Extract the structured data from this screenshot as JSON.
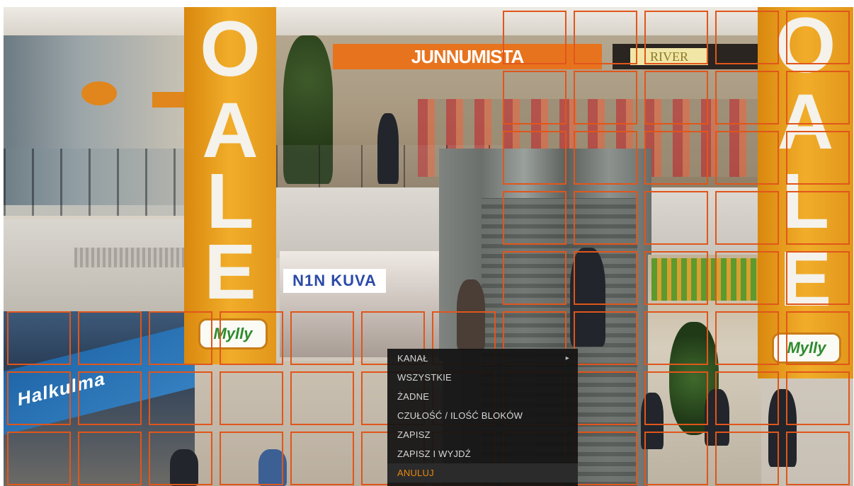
{
  "banners": {
    "left": {
      "letters": [
        "O",
        "A",
        "L",
        "E"
      ],
      "logo": "Mylly"
    },
    "right": {
      "letters": [
        "O",
        "A",
        "L",
        "E"
      ],
      "logo": "Mylly"
    }
  },
  "store_signs": {
    "upper_store": "JUNNUMISTA",
    "upper_store_right": "RIVER",
    "photo_store": "N1N KUVA",
    "lower_left_store": "Halkulma"
  },
  "colors": {
    "grid_cell": "#e0561b",
    "menu_background": "#121212",
    "menu_text": "#d7d7d7",
    "menu_selected": "#e9880f"
  },
  "context_menu": {
    "items": [
      {
        "label": "KANAŁ",
        "submenu_icon": "chevron-right-icon",
        "arrow": "▸"
      },
      {
        "label": "WSZYSTKIE"
      },
      {
        "label": "ŻADNE"
      },
      {
        "label": "CZUŁOŚĆ / ILOŚĆ BLOKÓW"
      },
      {
        "label": "ZAPISZ"
      },
      {
        "label": "ZAPISZ I WYJDŹ"
      },
      {
        "label": "ANULUJ",
        "selected": true
      }
    ]
  }
}
